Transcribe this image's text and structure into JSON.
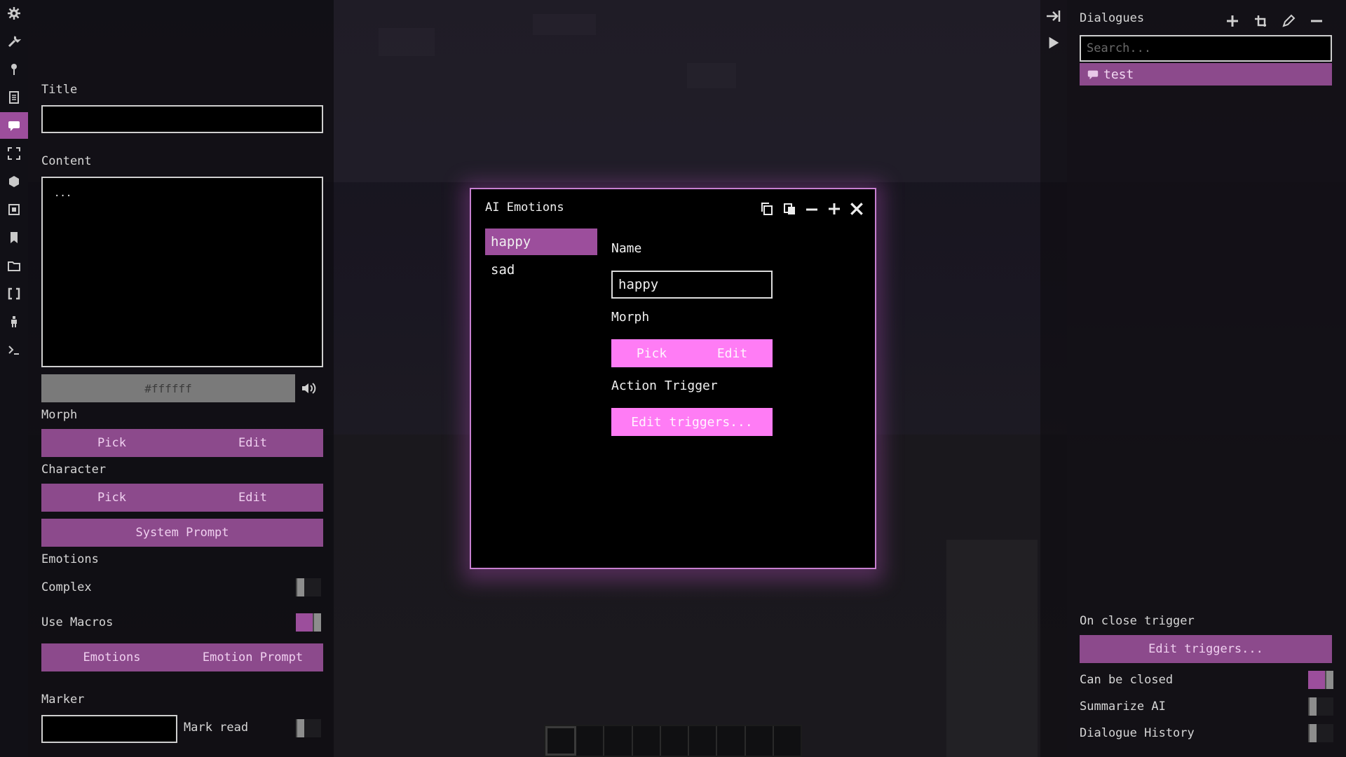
{
  "left": {
    "title_label": "Title",
    "title_value": "",
    "content_label": "Content",
    "content_value": "...",
    "color_value": "#ffffff",
    "morph_label": "Morph",
    "morph_pick": "Pick",
    "morph_edit": "Edit",
    "character_label": "Character",
    "character_pick": "Pick",
    "character_edit": "Edit",
    "system_prompt": "System Prompt",
    "emotions_label": "Emotions",
    "complex_label": "Complex",
    "complex_on": false,
    "use_macros_label": "Use Macros",
    "use_macros_on": true,
    "emotions_button": "Emotions",
    "emotion_prompt_button": "Emotion Prompt",
    "marker_label": "Marker",
    "marker_value": "",
    "mark_read_label": "Mark read",
    "mark_read_on": false
  },
  "right": {
    "title": "Dialogues",
    "search_placeholder": "Search...",
    "items": [
      "test"
    ],
    "on_close_label": "On close trigger",
    "edit_triggers": "Edit triggers...",
    "can_be_closed_label": "Can be closed",
    "can_be_closed_on": true,
    "summarize_ai_label": "Summarize AI",
    "summarize_ai_on": false,
    "dialogue_history_label": "Dialogue History",
    "dialogue_history_on": false
  },
  "modal": {
    "title": "AI Emotions",
    "emotions": [
      "happy",
      "sad"
    ],
    "selected": "happy",
    "name_label": "Name",
    "name_value": "happy",
    "morph_label": "Morph",
    "morph_pick": "Pick",
    "morph_edit": "Edit",
    "action_trigger_label": "Action Trigger",
    "edit_triggers": "Edit triggers..."
  },
  "colors": {
    "accent": "#9c4e9c",
    "modal_button": "#ff7cf5",
    "modal_border": "#c77fd0"
  },
  "icons": {
    "rail": [
      "gear-icon",
      "wrench-icon",
      "pin-icon",
      "document-icon",
      "chat-icon",
      "fullscreen-icon",
      "cube-icon",
      "film-icon",
      "bookmark-icon",
      "folder-icon",
      "brackets-icon",
      "figure-icon",
      "terminal-icon"
    ],
    "toolbar": [
      "collapse-right-icon",
      "play-icon"
    ]
  }
}
